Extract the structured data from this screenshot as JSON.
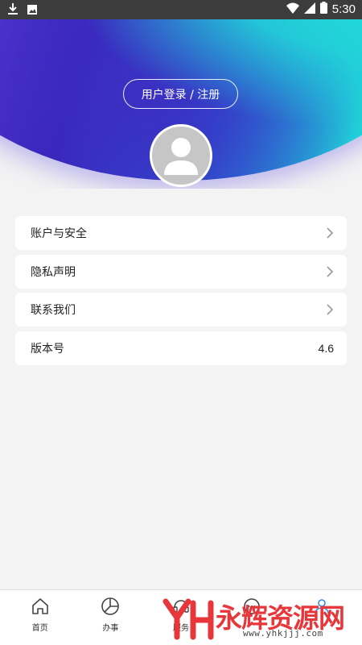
{
  "status_bar": {
    "time": "5:30",
    "icons": [
      "download-icon",
      "photo-icon",
      "wifi-icon",
      "signal-icon",
      "battery-icon"
    ]
  },
  "header": {
    "login_label": "用户登录 / 注册",
    "colors": {
      "cyan": "#21d9d9",
      "violet": "#3b1fb8",
      "blue": "#2960d8"
    }
  },
  "menu": {
    "items": [
      {
        "label": "账户与安全",
        "value": "",
        "chevron": true
      },
      {
        "label": "隐私声明",
        "value": "",
        "chevron": true
      },
      {
        "label": "联系我们",
        "value": "",
        "chevron": true
      },
      {
        "label": "版本号",
        "value": "4.6",
        "chevron": false
      }
    ]
  },
  "bottom_nav": {
    "items": [
      {
        "label": "首页",
        "icon": "home-icon"
      },
      {
        "label": "办事",
        "icon": "pie-chart-icon"
      },
      {
        "label": "服务",
        "icon": "service-icon"
      },
      {
        "label": "",
        "icon": "chat-icon"
      },
      {
        "label": "",
        "icon": "user-icon"
      }
    ],
    "active_color": "#2a8cf0"
  },
  "watermark": {
    "text": "永辉资源网",
    "url": "www.yhkjjj.com"
  }
}
